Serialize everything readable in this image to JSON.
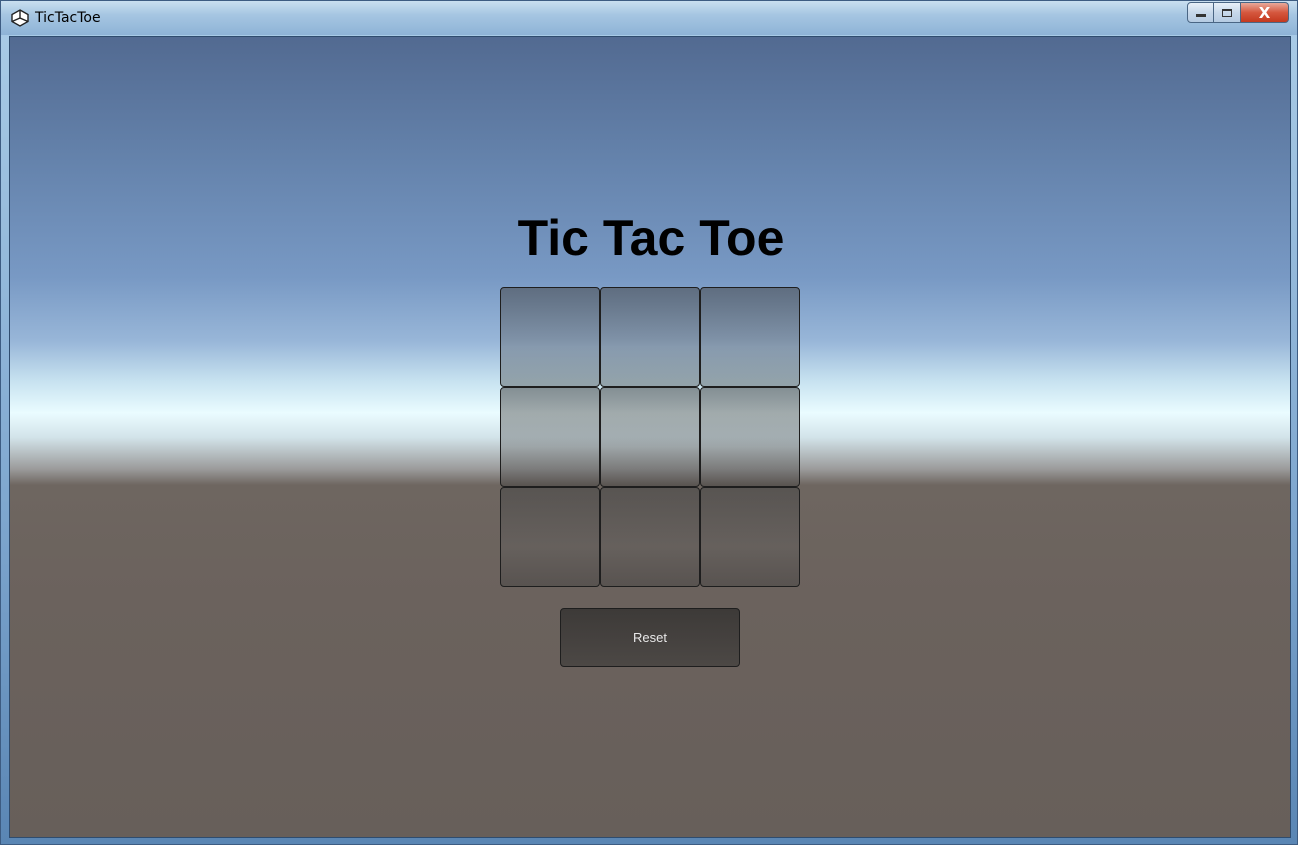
{
  "window": {
    "title": "TicTacToe",
    "close_glyph": "X"
  },
  "game": {
    "title": "Tic Tac Toe",
    "board": [
      [
        "",
        "",
        ""
      ],
      [
        "",
        "",
        ""
      ],
      [
        "",
        "",
        ""
      ]
    ],
    "reset_label": "Reset"
  },
  "icons": {
    "app": "unity-logo-icon",
    "minimize": "minimize-icon",
    "maximize": "maximize-icon",
    "close": "close-icon"
  },
  "colors": {
    "title_text": "#000000",
    "button_text": "#e8e8e8",
    "close_button": "#c3391f"
  }
}
